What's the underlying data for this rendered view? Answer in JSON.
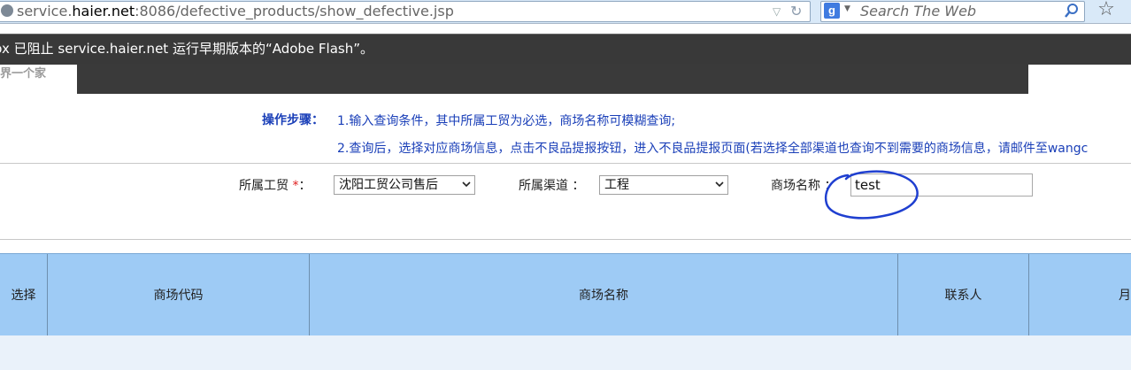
{
  "browser": {
    "url_prefix": "service.",
    "url_domain": "haier.net",
    "url_rest": ":8086/defective_products/show_defective.jsp",
    "search_placeholder": "Search The Web",
    "engine_glyph": "g"
  },
  "notification": {
    "text": "fox 已阻止 service.haier.net 运行早期版本的“Adobe Flash”。"
  },
  "banner": {
    "logo_text": "界一个家"
  },
  "instructions": {
    "label": "操作步骤：",
    "step1": "1.输入查询条件，其中所属工贸为必选，商场名称可模糊查询;",
    "step2": "2.查询后，选择对应商场信息，点击不良品提报按钮，进入不良品提报页面(若选择全部渠道也查询不到需要的商场信息，请邮件至wangc"
  },
  "form": {
    "trade_label": "所属工贸",
    "required_mark": "*",
    "colon": "：",
    "trade_value": "沈阳工贸公司售后",
    "channel_label": "所属渠道 ：",
    "channel_value": "工程",
    "market_label": "商场名称 ：",
    "market_value": "test"
  },
  "table": {
    "columns": [
      "选择",
      "商场代码",
      "商场名称",
      "联系人",
      "月"
    ]
  },
  "colors": {
    "instruction_text": "#1a3fb8",
    "table_header_bg": "#9ecbf5",
    "annotation_ink": "#1f3fd0"
  }
}
